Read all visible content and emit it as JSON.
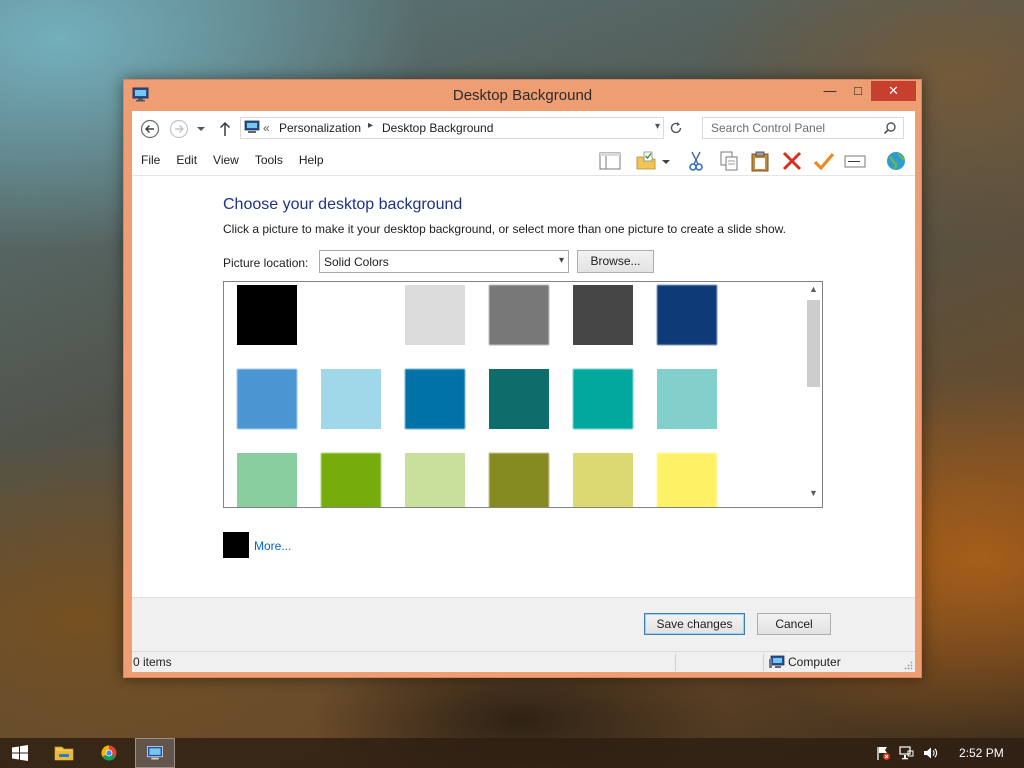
{
  "window": {
    "title": "Desktop Background",
    "minimize_glyph": "—",
    "maximize_glyph": "□",
    "close_glyph": "✕",
    "frame_color": "#ef9e74",
    "close_color": "#c7402f"
  },
  "nav": {
    "back_icon": "back-arrow-icon",
    "forward_icon": "forward-arrow-icon",
    "up_icon": "up-arrow-icon",
    "breadcrumb_overflow": "«",
    "breadcrumb": [
      "Personalization",
      "Desktop Background"
    ],
    "breadcrumb_separator": "▸",
    "dropdown_glyph": "▾",
    "search_placeholder": "Search Control Panel"
  },
  "menu": [
    "File",
    "Edit",
    "View",
    "Tools",
    "Help"
  ],
  "toolbar_icons": [
    "preview-pane-icon",
    "properties-folder-icon",
    "cut-icon",
    "copy-icon",
    "paste-icon",
    "delete-icon",
    "checkmark-icon",
    "rename-icon",
    "globe-icon"
  ],
  "content": {
    "heading": "Choose your desktop background",
    "subtext": "Click a picture to make it your desktop background, or select more than one picture to create a slide show.",
    "location_label": "Picture location:",
    "location_value": "Solid Colors",
    "browse_label": "Browse...",
    "more_label": "More...",
    "more_color": "#000000"
  },
  "swatches": [
    [
      "#000000",
      "#ffffff",
      "#dcdcdc",
      "#787878",
      "#464646",
      "#0e3b78"
    ],
    [
      "#4a95d2",
      "#a0d8ea",
      "#0072a8",
      "#0e6d6b",
      "#00a89d",
      "#83cfcc"
    ],
    [
      "#88ce9f",
      "#76ac0b",
      "#c8e09c",
      "#868b21",
      "#dcd872",
      "#fdf265"
    ]
  ],
  "footer": {
    "save_label": "Save changes",
    "cancel_label": "Cancel"
  },
  "status": {
    "items": "0 items",
    "location": "Computer"
  },
  "taskbar": {
    "apps": [
      "start-icon",
      "file-explorer-icon",
      "chrome-icon",
      "control-panel-icon"
    ],
    "tray": [
      "action-center-flag-icon",
      "network-icon",
      "volume-icon"
    ],
    "clock": "2:52 PM"
  }
}
